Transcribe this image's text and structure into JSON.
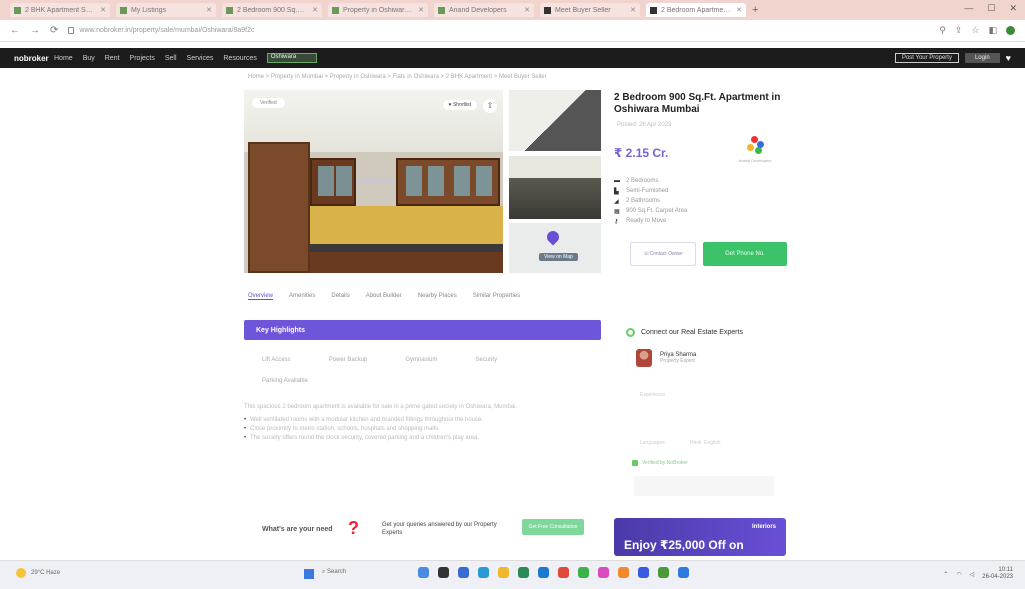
{
  "browser": {
    "tabs": [
      {
        "label": "2 BHK Apartment Sale in Oshiwara",
        "active": false
      },
      {
        "label": "My Listings",
        "active": false
      },
      {
        "label": "2 Bedroom 900 Sq.Ft. Apartment",
        "active": false
      },
      {
        "label": "Property in Oshiwara Mumbai",
        "active": false
      },
      {
        "label": "Anand Developers",
        "active": false
      },
      {
        "label": "Meet Buyer Seller",
        "active": false
      },
      {
        "label": "2 Bedroom Apartment in Oshiwara",
        "active": true
      }
    ],
    "new_tab": "+",
    "url": "www.nobroker.in/property/sale/mumbai/Oshiwara/8a9f2c"
  },
  "site": {
    "logo": "nobroker",
    "menu": [
      "Home",
      "Buy",
      "Rent",
      "Projects",
      "Sell",
      "Services",
      "Resources"
    ],
    "search_label": "Oshiwara",
    "post_property": "Post Your Property",
    "login": "Login"
  },
  "breadcrumb": "Home  >  Property in Mumbai  >  Property in Oshiwara  >  Flats in Oshiwara  >  2 BHK Apartment  >  Meet Buyer Seller",
  "gallery": {
    "badge": "Verified",
    "shortlist": "Shortlist",
    "map_label": "View on Map"
  },
  "property": {
    "title": "2 Bedroom 900 Sq.Ft. Apartment in Oshiwara Mumbai",
    "subtitle": "Posted: 26 Apr 2023",
    "price": "₹ 2.15 Cr.",
    "builder_name": "Anand Developers",
    "features": [
      "2 Bedrooms",
      "Semi-Furnished",
      "2 Bathrooms",
      "900 Sq.Ft. Carpet Area",
      "Ready to Move"
    ],
    "btn_contact": "Contact Owner",
    "btn_primary": "Get Phone No."
  },
  "tabs": [
    "Overview",
    "Amenities",
    "Details",
    "About Builder",
    "Nearby Places",
    "Similar Properties"
  ],
  "highlights": {
    "header": "Key Highlights",
    "row1": [
      "Lift Access",
      "Power Backup",
      "Gymnasium",
      "Security"
    ],
    "row2": "Parking Available",
    "intro": "This spacious 2 bedroom apartment is available for sale in a prime gated society in Oshiwara, Mumbai.",
    "bullets": [
      "Well ventilated rooms with a modular kitchen and branded fittings throughout the house.",
      "Close proximity to metro station, schools, hospitals and shopping malls.",
      "The society offers round the clock security, covered parking and a children's play area."
    ]
  },
  "experts": {
    "title": "Connect our Real Estate Experts",
    "name": "Priya Sharma",
    "role": "Property Expert",
    "line1": "Experience",
    "line2": "Languages",
    "line3": "Hindi, English",
    "verify": "Verified by NoBroker"
  },
  "needs": {
    "question": "What's are your need",
    "text": "Get your queries answered by our Property Experts",
    "button": "Get Free Consultation"
  },
  "promo": {
    "brand": "Interiors",
    "offer": "Enjoy ₹25,000 Off on"
  },
  "taskbar": {
    "weather": "29°C Haze",
    "search": "Search",
    "time": "10:11",
    "date": "26-04-2023"
  },
  "colors": {
    "accent": "#6f55d9",
    "green": "#3cc36a",
    "header_bg": "#1c1c1c"
  }
}
